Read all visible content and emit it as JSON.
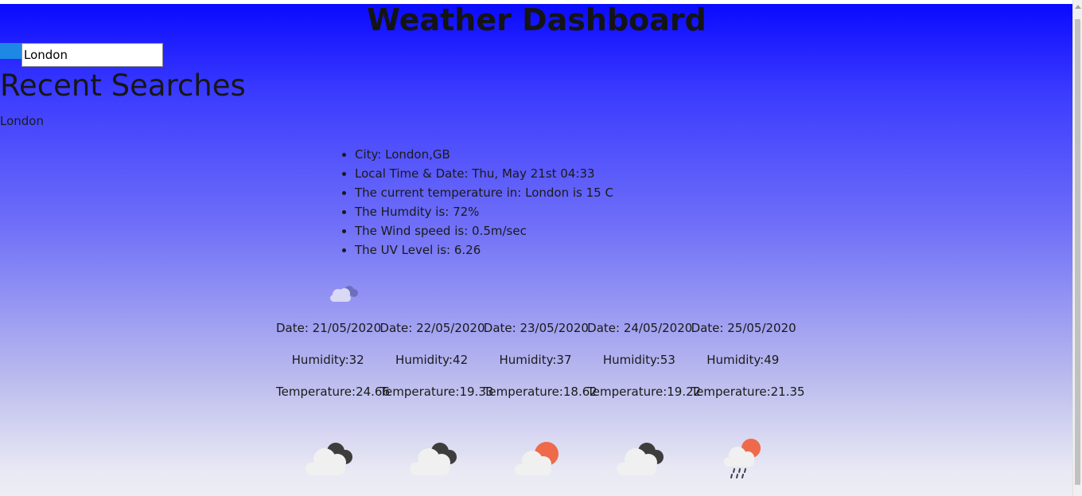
{
  "header": {
    "title": "Weather Dashboard"
  },
  "search": {
    "value": "London"
  },
  "recent": {
    "heading": "Recent Searches",
    "items": [
      "London"
    ]
  },
  "current": {
    "city": "City: London,GB",
    "local_time": "Local Time & Date: Thu, May 21st 04:33",
    "temperature": "The current temperature in: London is 15 C",
    "humidity": "The Humdity is: 72%",
    "wind": "The Wind speed is: 0.5m/sec",
    "uv": "The UV Level is: 6.26",
    "icon": "cloudy-icon"
  },
  "forecast": [
    {
      "date": "Date: 21/05/2020",
      "humidity": "Humidity:32",
      "temperature": "Temperature:24.66",
      "icon": "cloudy-icon"
    },
    {
      "date": "Date: 22/05/2020",
      "humidity": "Humidity:42",
      "temperature": "Temperature:19.33",
      "icon": "cloudy-icon"
    },
    {
      "date": "Date: 23/05/2020",
      "humidity": "Humidity:37",
      "temperature": "Temperature:18.62",
      "icon": "partly-sunny-icon"
    },
    {
      "date": "Date: 24/05/2020",
      "humidity": "Humidity:53",
      "temperature": "Temperature:19.22",
      "icon": "cloudy-icon"
    },
    {
      "date": "Date: 25/05/2020",
      "humidity": "Humidity:49",
      "temperature": "Temperature:21.35",
      "icon": "rain-sun-icon"
    }
  ],
  "colors": {
    "background_top": "#0a0aff",
    "background_bottom": "#ededf4",
    "button": "#1e88e5",
    "sun": "#ee6a4a",
    "dark_cloud": "#3d3d3d"
  }
}
